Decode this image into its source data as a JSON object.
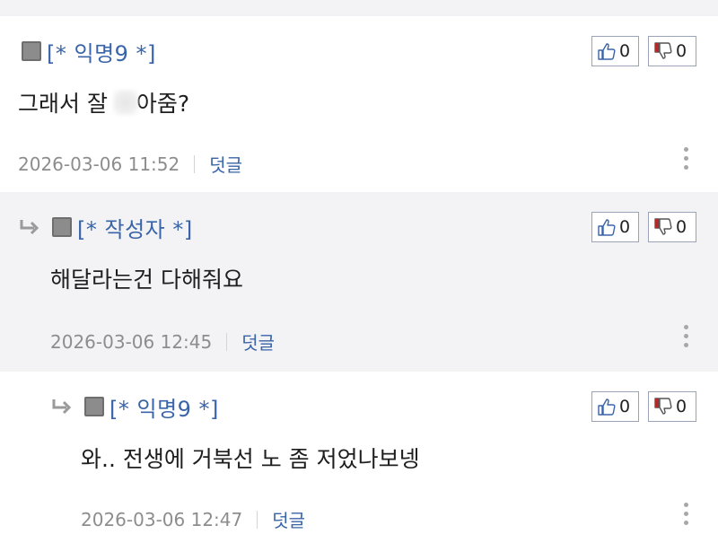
{
  "comments": [
    {
      "author": "[* 익명9 *]",
      "text_before": "그래서 잘 ",
      "text_after": "아줌?",
      "date": "2026-03-06 11:52",
      "reply_label": "덧글",
      "likes": "0",
      "dislikes": "0"
    },
    {
      "author": "[* 작성자 *]",
      "text": "해달라는건 다해줘요",
      "date": "2026-03-06 12:45",
      "reply_label": "덧글",
      "likes": "0",
      "dislikes": "0"
    },
    {
      "author": "[* 익명9 *]",
      "text": "와.. 전생에 거북선 노 좀 저었나보넹",
      "date": "2026-03-06 12:47",
      "reply_label": "덧글",
      "likes": "0",
      "dislikes": "0"
    }
  ],
  "icons": {
    "reply_arrow": "reply-arrow-icon",
    "avatar": "avatar-icon",
    "like": "thumbs-up-icon",
    "dislike": "thumbs-down-icon",
    "more": "more-vertical-icon"
  },
  "colors": {
    "author": "#3a64a8",
    "date": "#8d8d8d",
    "reply_link": "#3a64a8",
    "reply_bg": "#f3f3f5",
    "dislike_accent": "#b22a2a"
  }
}
